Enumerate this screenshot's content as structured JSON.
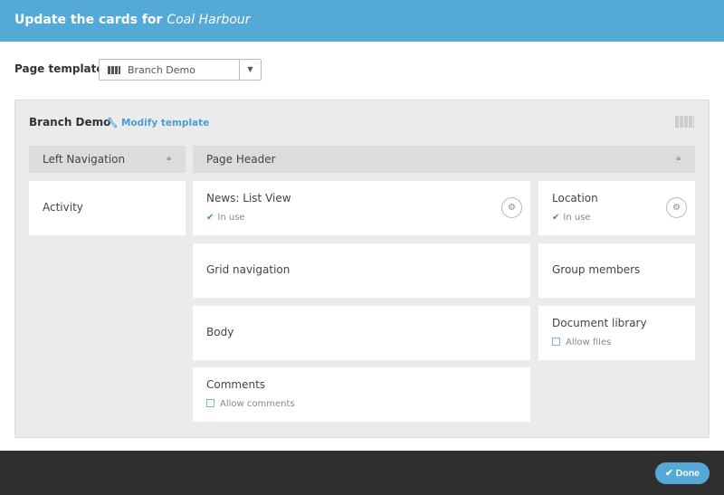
{
  "header": {
    "title_prefix": "Update the cards for",
    "title_place": "Coal Harbour"
  },
  "template": {
    "label": "Page template",
    "selected": "Branch Demo"
  },
  "panel": {
    "title": "Branch Demo",
    "modify_label": "Modify template"
  },
  "bars": {
    "left": "Left Navigation",
    "main": "Page Header"
  },
  "cards": {
    "activity": {
      "title": "Activity"
    },
    "news": {
      "title": "News: List View",
      "status": "In use"
    },
    "location": {
      "title": "Location",
      "status": "In use"
    },
    "grid": {
      "title": "Grid navigation"
    },
    "group": {
      "title": "Group members"
    },
    "body": {
      "title": "Body"
    },
    "doclib": {
      "title": "Document library",
      "option": "Allow files"
    },
    "comments": {
      "title": "Comments",
      "option": "Allow comments"
    }
  },
  "footer": {
    "done_label": "Done"
  },
  "colors": {
    "accent": "#55a9d6",
    "footer": "#2f2f2f",
    "panel": "#ebebeb"
  }
}
